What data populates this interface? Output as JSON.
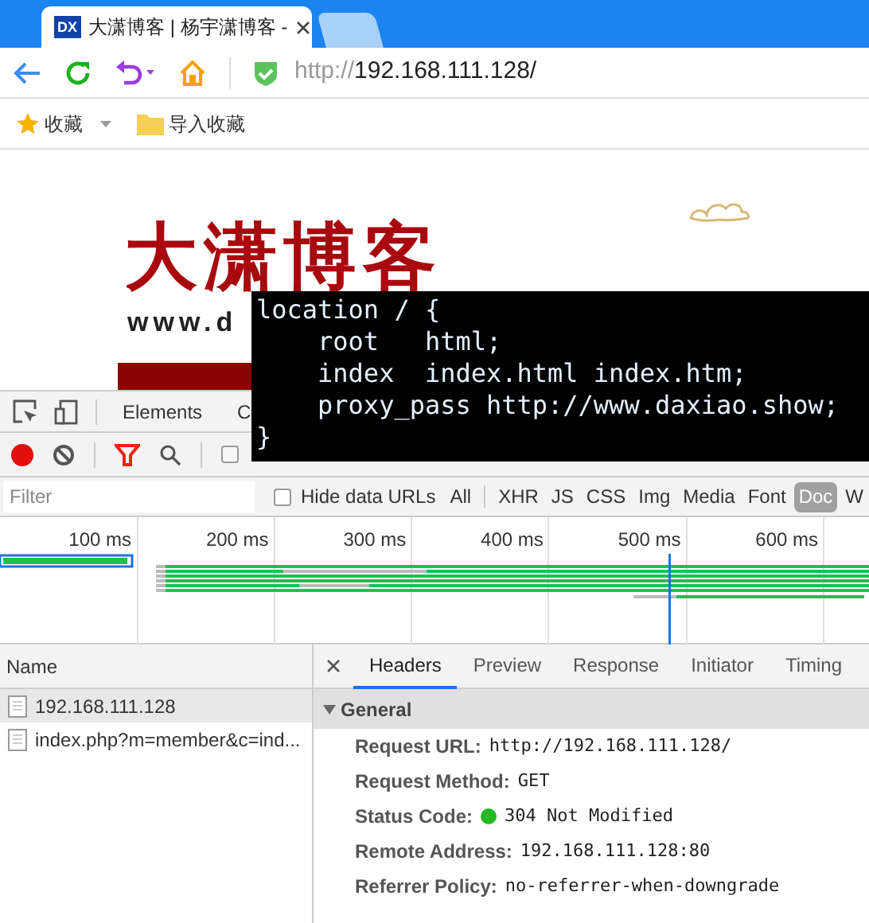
{
  "tabs": [
    {
      "logo": "DX",
      "title": "大潇博客 | 杨宇潇博客 -",
      "selected": true
    },
    {
      "selected": false
    }
  ],
  "address_bar": {
    "url": "http://192.168.111.128/"
  },
  "bookmarks": [
    {
      "kind": "menu",
      "label": "收藏"
    },
    {
      "kind": "folder",
      "label": "导入收藏"
    }
  ],
  "page": {
    "logo_text": "大潇博客",
    "site_url": "www.d"
  },
  "code_overlay": {
    "lines": [
      "location / {",
      "    root   html;",
      "    index  index.html index.htm;",
      "    proxy_pass http://www.daxiao.show;",
      "}"
    ]
  },
  "devtools": {
    "panels": [
      {
        "label": "Elements",
        "selected": false
      },
      {
        "label": "C",
        "selected": false
      }
    ],
    "recording": true,
    "preserve_log": {
      "checked": false
    },
    "filter": {
      "placeholder": "Filter"
    },
    "hide_data_urls": {
      "label": "Hide data URLs",
      "checked": false
    },
    "types": [
      {
        "label": "All",
        "selected": false
      },
      {
        "label": "XHR",
        "selected": false
      },
      {
        "label": "JS",
        "selected": false
      },
      {
        "label": "CSS",
        "selected": false
      },
      {
        "label": "Img",
        "selected": false
      },
      {
        "label": "Media",
        "selected": false
      },
      {
        "label": "Font",
        "selected": false
      },
      {
        "label": "Doc",
        "selected": true
      },
      {
        "label": "W",
        "selected": false
      }
    ],
    "timeline_ticks": [
      "100 ms",
      "200 ms",
      "300 ms",
      "400 ms",
      "500 ms",
      "600 ms"
    ],
    "requests": {
      "header": "Name",
      "rows": [
        {
          "name": "192.168.111.128",
          "selected": true
        },
        {
          "name": "index.php?m=member&c=ind...",
          "selected": false
        }
      ]
    },
    "detail_tabs": [
      {
        "label": "Headers",
        "selected": true
      },
      {
        "label": "Preview",
        "selected": false
      },
      {
        "label": "Response",
        "selected": false
      },
      {
        "label": "Initiator",
        "selected": false
      },
      {
        "label": "Timing",
        "selected": false
      }
    ],
    "general": {
      "title": "General",
      "expanded": true,
      "rows": [
        {
          "key": "Request URL:",
          "value": "http://192.168.111.128/"
        },
        {
          "key": "Request Method:",
          "value": "GET"
        },
        {
          "key": "Status Code:",
          "value": "304 Not Modified",
          "kind": "status"
        },
        {
          "key": "Remote Address:",
          "value": "192.168.111.128:80"
        },
        {
          "key": "Referrer Policy:",
          "value": "no-referrer-when-downgrade"
        }
      ]
    }
  }
}
